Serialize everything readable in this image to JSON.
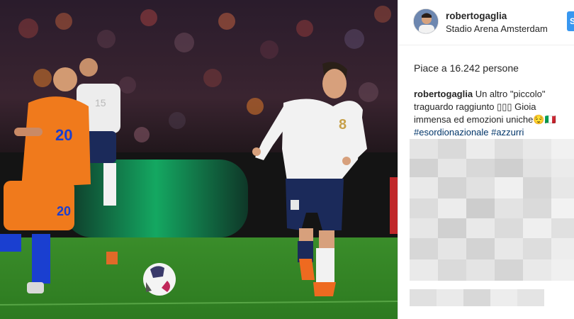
{
  "post": {
    "username": "robertogaglia",
    "location": "Stadio Arena Amsterdam",
    "follow_label": "S",
    "likes_text": "Piace a 16.242 persone",
    "caption": {
      "username": "robertogaglia",
      "text": " Un altro \"piccolo\" traguardo raggiunto ▯▯▯ Gioia immensa ed emozioni uniche😌🇮🇹",
      "hashtag_1": "#esordionazionale",
      "hashtag_2": "#azzurri"
    }
  },
  "photo": {
    "orange_player_numbers": [
      "20",
      "20"
    ],
    "white_player_number": "8",
    "back_player_number": "15"
  },
  "colors": {
    "pitch": "#3f8f2c",
    "netherlands_orange": "#f07a1c",
    "italy_white": "#f2f2f2",
    "italy_navy": "#1b2a5a",
    "link": "#003569",
    "follow_blue": "#3897f0"
  },
  "icons": [
    "avatar-image",
    "soccer-ball"
  ]
}
